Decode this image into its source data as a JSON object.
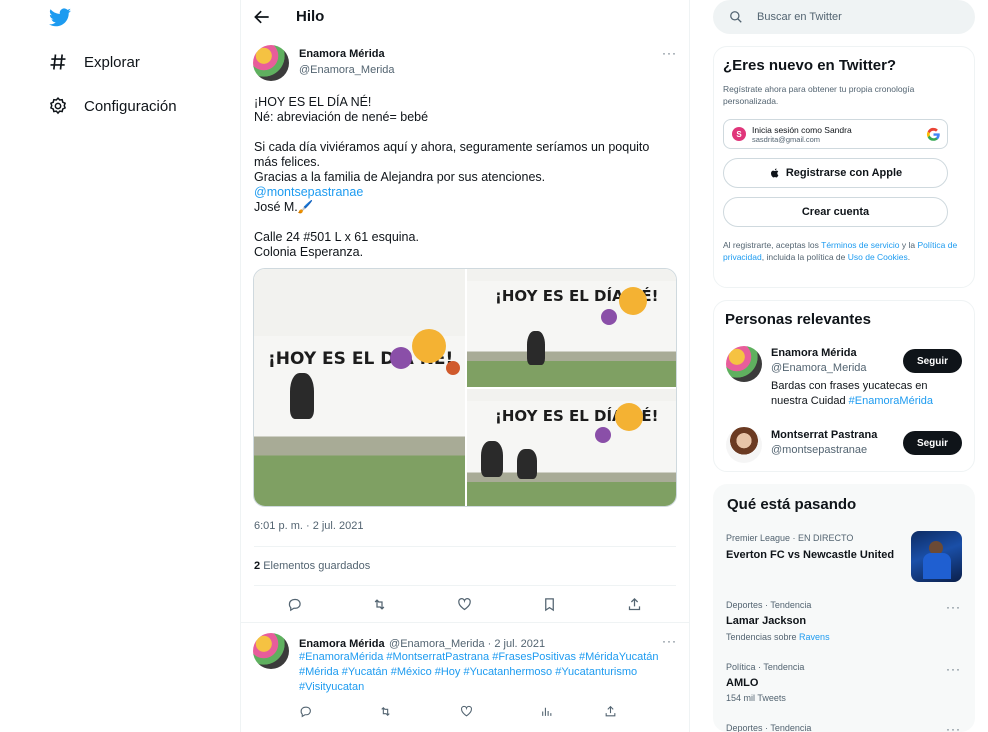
{
  "colors": {
    "accent": "#1d9bf0",
    "text": "#0f1419",
    "muted": "#536471",
    "border": "#eff3f4"
  },
  "nav": {
    "logo_icon": "twitter-bird-icon",
    "items": [
      {
        "icon": "hashtag-icon",
        "label": "Explorar"
      },
      {
        "icon": "gear-icon",
        "label": "Configuración"
      }
    ]
  },
  "header": {
    "back_icon": "arrow-left-icon",
    "title": "Hilo"
  },
  "tweet": {
    "name": "Enamora Mérida",
    "handle": "@Enamora_Merida",
    "more_icon": "more-dots-icon",
    "text_1": "¡HOY ES EL DÍA NÉ!\nNé: abreviación de nené= bebé\n\nSi cada día viviéramos aquí y ahora, seguramente seríamos un poquito más felices.\nGracias a la familia de Alejandra por sus atenciones.",
    "mention": "@montsepastranae",
    "text_2": "José M.🖌️\n\nCalle 24 #501 L x 61 esquina.\nColonia Esperanza.",
    "photo_text": "¡HOY ES EL DÍA NÉ!",
    "timestamp": "6:01 p. m. · 2 jul. 2021",
    "saves_count": "2",
    "saves_label": "Elementos guardados",
    "actions": [
      "reply-icon",
      "retweet-icon",
      "like-icon",
      "bookmark-icon",
      "share-icon"
    ]
  },
  "reply": {
    "name": "Enamora Mérida",
    "handle_date": "@Enamora_Merida · 2 jul. 2021",
    "hashtags": "#EnamoraMérida #MontserratPastrana #FrasesPositivas #MéridaYucatán #Mérida #Yucatán #México #Hoy #Yucatanhermoso #Yucatanturismo #Visityucatan",
    "actions": [
      "reply-icon",
      "retweet-icon",
      "like-icon",
      "analytics-icon",
      "share-icon"
    ]
  },
  "search": {
    "placeholder": "Buscar en Twitter"
  },
  "signup": {
    "title": "¿Eres nuevo en Twitter?",
    "subtitle": "Regístrate ahora para obtener tu propia cronología personalizada.",
    "google_name": "Inicia sesión como Sandra",
    "google_email": "sasdrita@gmail.com",
    "google_avatar_letter": "S",
    "apple_label": "Registrarse con Apple",
    "create_label": "Crear cuenta",
    "legal_1": "Al registrarte, aceptas los ",
    "legal_terms": "Términos de servicio",
    "legal_2": " y la ",
    "legal_privacy": "Política de privacidad",
    "legal_3": ", incluida la política de ",
    "legal_cookies": "Uso de Cookies",
    "legal_4": "."
  },
  "relevant": {
    "title": "Personas relevantes",
    "people": [
      {
        "name": "Enamora Mérida",
        "handle": "@Enamora_Merida",
        "bio": "Bardas con frases yucatecas en nuestra Cuidad ",
        "bio_tag": "#EnamoraMérida",
        "follow": "Seguir"
      },
      {
        "name": "Montserrat Pastrana",
        "handle": "@montsepastranae",
        "follow": "Seguir"
      }
    ]
  },
  "trends": {
    "title": "Qué está pasando",
    "items": [
      {
        "meta": "Premier League · EN DIRECTO",
        "title": "Everton FC vs Newcastle United"
      },
      {
        "meta": "Deportes · Tendencia",
        "title": "Lamar Jackson",
        "sub_prefix": "Tendencias sobre ",
        "sub_tag": "Ravens"
      },
      {
        "meta": "Política · Tendencia",
        "title": "AMLO",
        "sub": "154 mil Tweets"
      },
      {
        "meta": "Deportes · Tendencia"
      }
    ]
  }
}
